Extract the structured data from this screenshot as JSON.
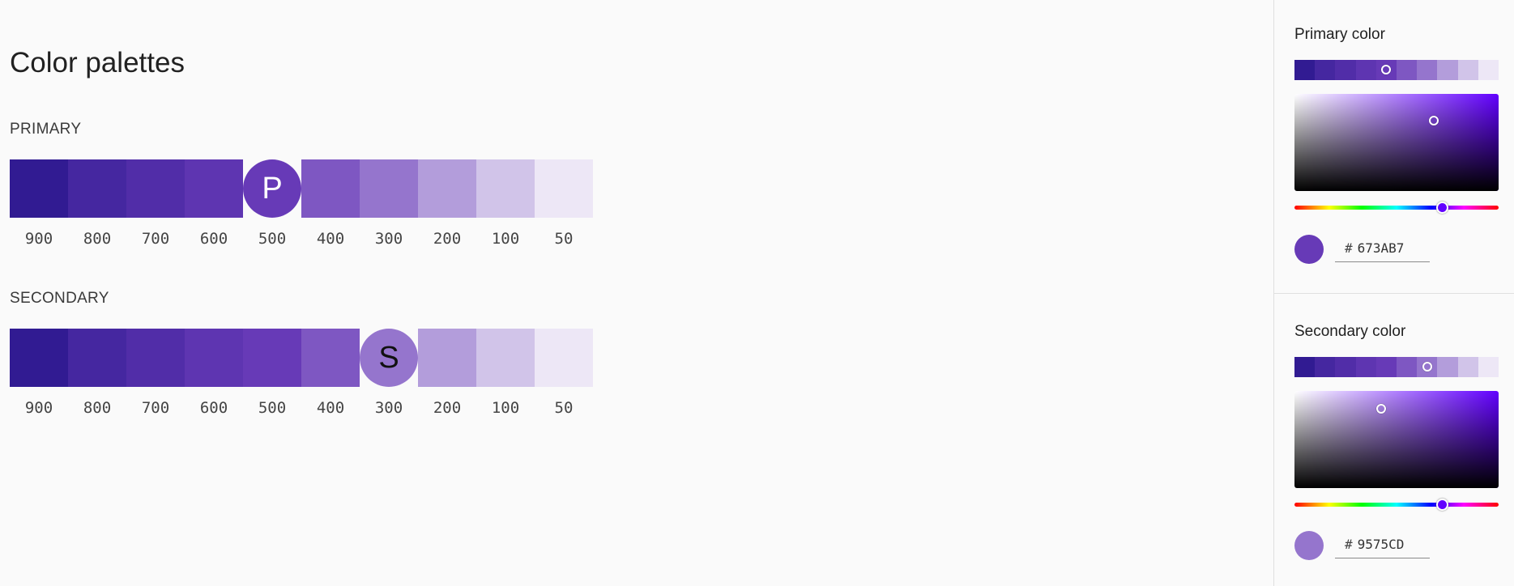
{
  "page_title": "Color palettes",
  "primary": {
    "label": "PRIMARY",
    "marker": "P",
    "marker_index": 4,
    "swatches": [
      {
        "tone": "900",
        "color": "#311b92"
      },
      {
        "tone": "800",
        "color": "#4527a0"
      },
      {
        "tone": "700",
        "color": "#512da8"
      },
      {
        "tone": "600",
        "color": "#5e35b1"
      },
      {
        "tone": "500",
        "color": "#673ab7"
      },
      {
        "tone": "400",
        "color": "#7e57c2"
      },
      {
        "tone": "300",
        "color": "#9575cd"
      },
      {
        "tone": "200",
        "color": "#b39ddb"
      },
      {
        "tone": "100",
        "color": "#d1c4e9"
      },
      {
        "tone": "50",
        "color": "#ede7f6"
      }
    ]
  },
  "secondary": {
    "label": "SECONDARY",
    "marker": "S",
    "marker_index": 6,
    "swatches": [
      {
        "tone": "900",
        "color": "#311b92"
      },
      {
        "tone": "800",
        "color": "#4527a0"
      },
      {
        "tone": "700",
        "color": "#512da8"
      },
      {
        "tone": "600",
        "color": "#5e35b1"
      },
      {
        "tone": "500",
        "color": "#673ab7"
      },
      {
        "tone": "400",
        "color": "#7e57c2"
      },
      {
        "tone": "300",
        "color": "#9575cd"
      },
      {
        "tone": "200",
        "color": "#b39ddb"
      },
      {
        "tone": "100",
        "color": "#d1c4e9"
      },
      {
        "tone": "50",
        "color": "#ede7f6"
      }
    ]
  },
  "panel": {
    "primary": {
      "title": "Primary color",
      "hash": "#",
      "hex": "673AB7",
      "selected_strip_index": 4,
      "color": "#673ab7"
    },
    "secondary": {
      "title": "Secondary color",
      "hash": "#",
      "hex": "9575CD",
      "selected_strip_index": 6,
      "color": "#9575cd"
    }
  }
}
